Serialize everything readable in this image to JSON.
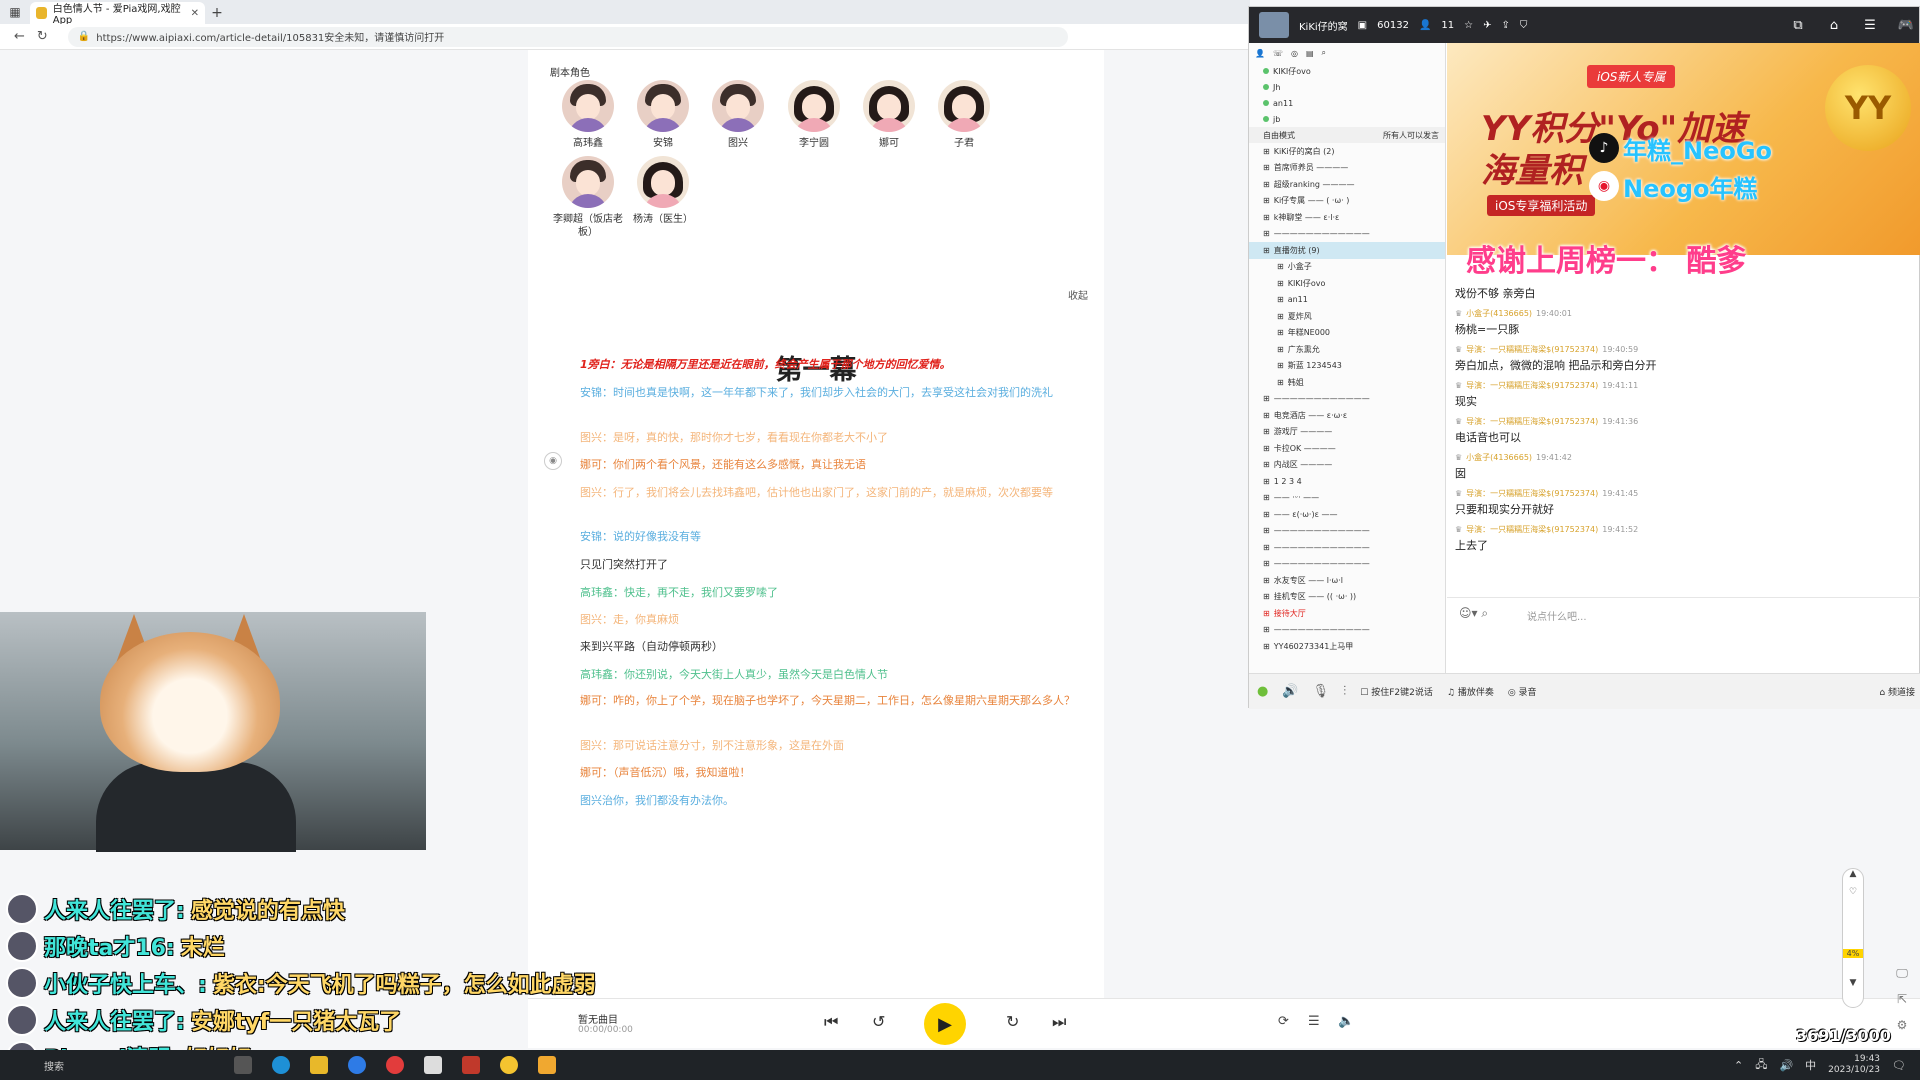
{
  "browser": {
    "tab_title": "白色情人节 - 爱Pia戏网,戏腔App",
    "url": "https://www.aipiaxi.com/article-detail/105831安全未知，请谨慎访问打开"
  },
  "script": {
    "section_title": "剧本角色",
    "roles": [
      {
        "name": "高玮鑫",
        "gender": "m"
      },
      {
        "name": "安锦",
        "gender": "m"
      },
      {
        "name": "图兴",
        "gender": "m"
      },
      {
        "name": "李宁圆",
        "gender": "f"
      },
      {
        "name": "娜可",
        "gender": "f"
      },
      {
        "name": "子君",
        "gender": "f"
      },
      {
        "name": "李卿超（饭店老板）",
        "gender": "m"
      },
      {
        "name": "杨涛（医生）",
        "gender": "f"
      }
    ],
    "collapse_label": "收起",
    "act_title": "第一幕",
    "lines": [
      {
        "text": "1旁白：无论是相隔万里还是近在眼前，终会产生属于那个地方的回忆爱情。",
        "color": "#e0221c",
        "bold": true
      },
      {
        "text": "安锦：时间也真是快啊，这一年年都下来了，我们却步入社会的大门，去享受这社会对我们的洗礼",
        "color": "#5aaedf"
      },
      {
        "text": "图兴：是呀，真的快，那时你才七岁，看看现在你都老大不小了",
        "color": "#f4b57a"
      },
      {
        "text": "娜可：你们两个看个风景，还能有这么多感慨，真让我无语",
        "color": "#e8843c"
      },
      {
        "text": "图兴：行了，我们将会儿去找玮鑫吧，估计他也出家门了，这家门前的产，就是麻烦，次次都要等",
        "color": "#f4b57a"
      },
      {
        "text": "安锦：说的好像我没有等",
        "color": "#5aaedf"
      },
      {
        "text": "只见门突然打开了",
        "color": "#333333"
      },
      {
        "text": "高玮鑫：快走，再不走，我们又要罗嗦了",
        "color": "#4fc08d"
      },
      {
        "text": "图兴：走，你真麻烦",
        "color": "#f4b57a"
      },
      {
        "text": "来到兴平路（自动停顿两秒）",
        "color": "#333333"
      },
      {
        "text": "高玮鑫：你还别说，今天大街上人真少，虽然今天是白色情人节",
        "color": "#4fc08d"
      },
      {
        "text": "娜可：咋的，你上了个学，现在脑子也学坏了，今天星期二，工作日，怎么像星期六星期天那么多人？",
        "color": "#e8843c"
      },
      {
        "text": "图兴：那可说话注意分寸，别不注意形象，这是在外面",
        "color": "#f4b57a"
      },
      {
        "text": "娜可：（声音低沉）哦，我知道啦！",
        "color": "#e8843c"
      },
      {
        "text": "图兴治你，我们都没有办法你。",
        "color": "#5aaedf"
      }
    ]
  },
  "yy": {
    "channel_name": "KiKi仔的窝",
    "viewers": "60132",
    "members": "11",
    "left_users": [
      "KIKI仔ovo",
      "Jh",
      "an11",
      "jb"
    ],
    "mode_label": "自由模式",
    "speak_label": "所有人可以发言",
    "channel_rows": [
      "KiKi仔的窝白 (2)",
      "首席师养员 ————",
      "超级ranking ————",
      "Ki仔专属 —— ( ·ω· )",
      "k神聊堂 —— ε·l·ε",
      "————————————",
      "直播勿扰 (9)",
      "小盒子",
      "KIKI仔ovo",
      "an11",
      "夏炸风",
      "年糕NE000",
      "广东熏允",
      "斯蓝 1234543",
      "韩姐",
      "————————————",
      "电竞酒店 —— ε·ω·ε",
      "游戏厅 ————",
      "卡拉OK ————",
      "内战区 ————",
      "1 2 3 4",
      "—— ·ᵕ· ——",
      "—— ε(·ω·)ε ——",
      "————————————",
      "————————————",
      "————————————",
      "水友专区 —— l·ω·l",
      "挂机专区 —— (( ·ω· ))",
      "接待大厅",
      "————————————",
      "YY460273341上马甲"
    ],
    "banner": {
      "tag": "iOS新人专属",
      "line1": "YY积分\"Yo\"加速",
      "line2": "海量积",
      "line3": "iOS专享福利活动",
      "coin": "YY",
      "overlay1": "年糕_NeoGo",
      "overlay2": "Neogo年糕"
    },
    "thanks": "感谢上周榜一： 酷爹",
    "chat": [
      {
        "user": "",
        "time": "",
        "text": "戏份不够 亲旁白"
      },
      {
        "user": "小盒子(4136665)",
        "time": "19:40:01",
        "text": "杨桃=一只豚"
      },
      {
        "user": "导演：一只糯糯压海梁$(91752374)",
        "time": "19:40:59",
        "text": "旁白加点，微微的混响 把品示和旁白分开"
      },
      {
        "user": "导演：一只糯糯压海梁$(91752374)",
        "time": "19:41:11",
        "text": "现实"
      },
      {
        "user": "导演：一只糯糯压海梁$(91752374)",
        "time": "19:41:36",
        "text": "电话音也可以"
      },
      {
        "user": "小盒子(4136665)",
        "time": "19:41:42",
        "text": "囡"
      },
      {
        "user": "导演：一只糯糯压海梁$(91752374)",
        "time": "19:41:45",
        "text": "只要和现实分开就好"
      },
      {
        "user": "导演：一只糯糯压海梁$(91752374)",
        "time": "19:41:52",
        "text": "上去了"
      }
    ],
    "input_placeholder": "说点什么吧...",
    "bottom": {
      "ptt": "按住F2键2说话",
      "accompany": "播放伴奏",
      "record": "录音",
      "channel_mgmt": "频道接"
    }
  },
  "danmu": [
    {
      "who": "人来人往罢了:",
      "msg": "感觉说的有点快"
    },
    {
      "who": "那晚ta才16:",
      "msg": "末烂"
    },
    {
      "who": "小伙子快上车、:",
      "msg": "紫衣:今天飞机了吗糕子，怎么如此虚弱"
    },
    {
      "who": "人来人往罢了:",
      "msg": "安娜tyf一只猪太瓦了"
    },
    {
      "who": "Pkunzi清明:",
      "msg": "好好好"
    }
  ],
  "player": {
    "song": "暂无曲目",
    "time": "00:00/00:00"
  },
  "follow_count": "3691/3000",
  "scroll_pct": "4%",
  "taskbar": {
    "search": "搜索",
    "time": "19:43",
    "date": "2023/10/23"
  }
}
